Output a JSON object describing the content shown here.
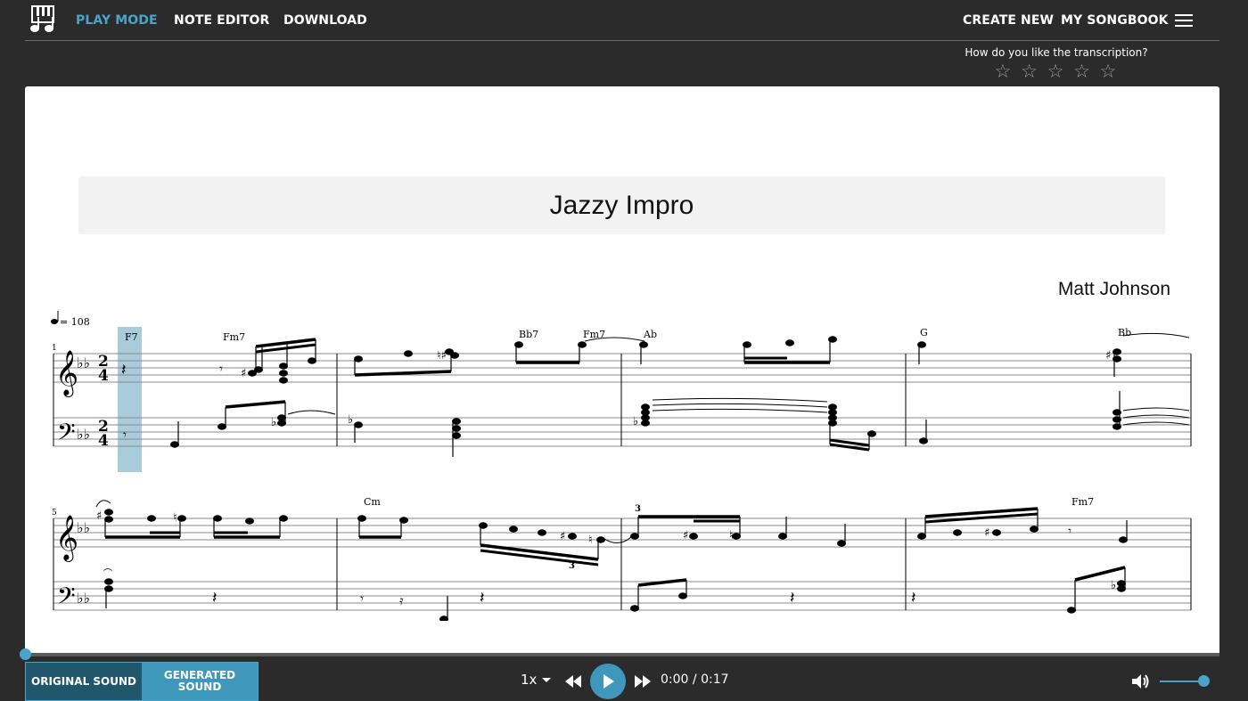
{
  "nav": {
    "play_mode": "PLAY MODE",
    "note_editor": "NOTE EDITOR",
    "download": "DOWNLOAD",
    "create_new": "CREATE NEW",
    "my_songbook": "MY SONGBOOK"
  },
  "rating": {
    "question": "How do you like the transcription?",
    "stars": [
      "☆",
      "☆",
      "☆",
      "☆",
      "☆"
    ]
  },
  "score": {
    "title": "Jazzy Impro",
    "composer": "Matt Johnson",
    "tempo": "= 108",
    "measure_numbers": [
      "1",
      "5"
    ],
    "time_signature": {
      "top": "2",
      "bottom": "4"
    },
    "chords_system1": [
      "F7",
      "Fm7",
      "Bb7",
      "Fm7",
      "Ab",
      "G",
      "Bb"
    ],
    "chords_system2": [
      "Cm",
      "Fm7"
    ],
    "tuplets": [
      "3",
      "3"
    ]
  },
  "player": {
    "original_sound": "ORIGINAL SOUND",
    "generated_sound": "GENERATED SOUND",
    "speed": "1x",
    "current_time": "0:00",
    "separator": "/",
    "total_time": "0:17",
    "progress_fraction": 0,
    "volume_fraction": 0.87
  },
  "colors": {
    "accent": "#4aa3c8",
    "background": "#2b2b2b",
    "highlight": "#a8ccd9"
  },
  "icons": {
    "logo": "piano-note-logo-icon",
    "menu": "hamburger-menu-icon",
    "rewind": "rewind-icon",
    "play": "play-icon",
    "forward": "fast-forward-icon",
    "volume": "volume-icon"
  }
}
